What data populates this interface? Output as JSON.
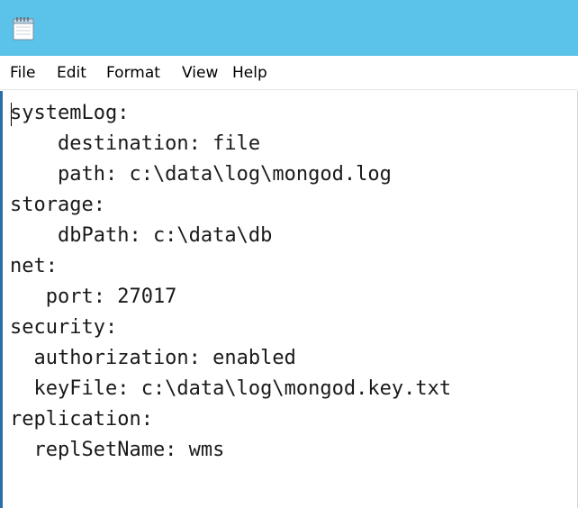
{
  "menubar": {
    "items": [
      {
        "label": "File"
      },
      {
        "label": "Edit"
      },
      {
        "label": "Format"
      },
      {
        "label": "View"
      },
      {
        "label": "Help"
      }
    ]
  },
  "editor": {
    "lines": [
      "systemLog:",
      "    destination: file",
      "    path: c:\\data\\log\\mongod.log",
      "storage:",
      "    dbPath: c:\\data\\db",
      "net:",
      "   port: 27017",
      "security:",
      "  authorization: enabled",
      "  keyFile: c:\\data\\log\\mongod.key.txt",
      "replication:",
      "  replSetName: wms"
    ]
  },
  "icons": {
    "app_icon": "notepad-icon"
  }
}
